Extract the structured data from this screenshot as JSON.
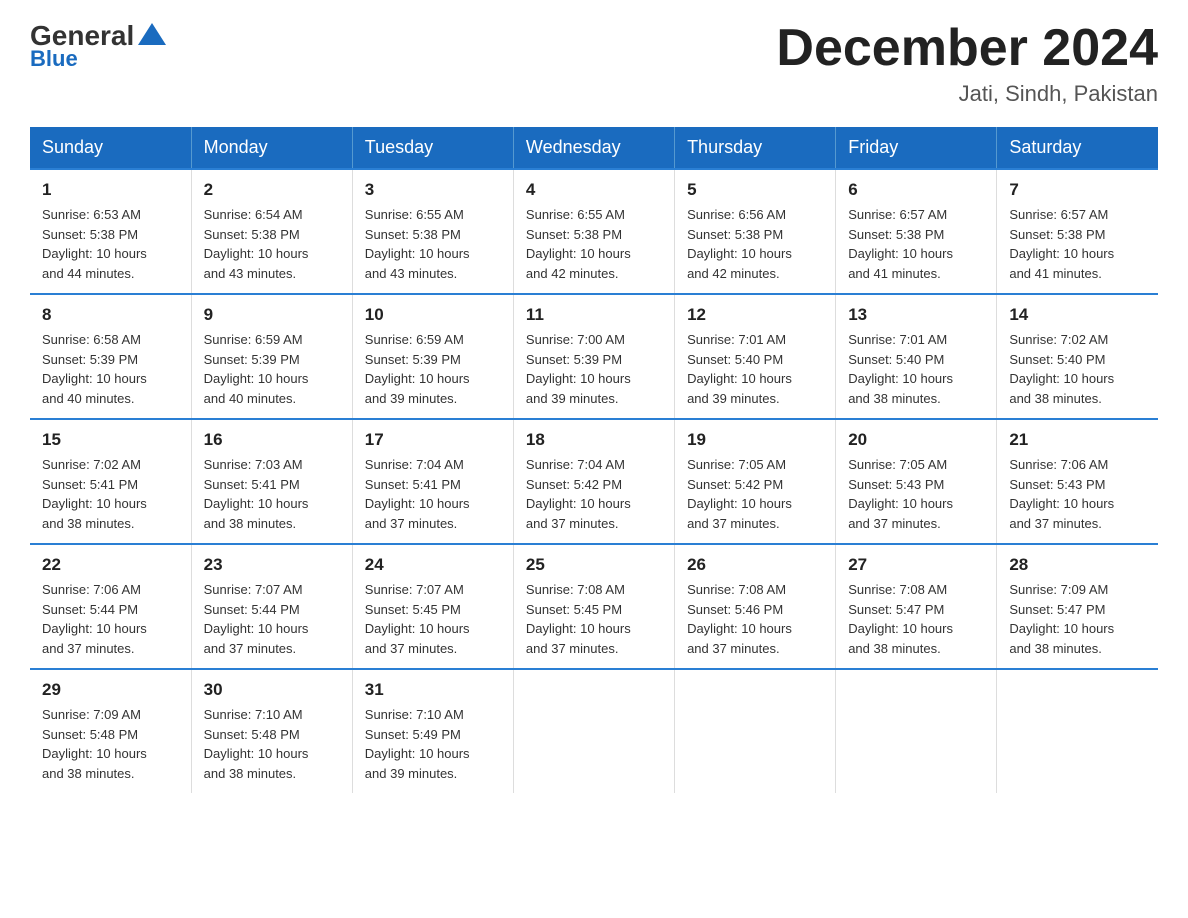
{
  "logo": {
    "general": "General",
    "blue": "Blue"
  },
  "title": "December 2024",
  "location": "Jati, Sindh, Pakistan",
  "days_of_week": [
    "Sunday",
    "Monday",
    "Tuesday",
    "Wednesday",
    "Thursday",
    "Friday",
    "Saturday"
  ],
  "weeks": [
    [
      {
        "day": "1",
        "sunrise": "6:53 AM",
        "sunset": "5:38 PM",
        "daylight": "10 hours and 44 minutes."
      },
      {
        "day": "2",
        "sunrise": "6:54 AM",
        "sunset": "5:38 PM",
        "daylight": "10 hours and 43 minutes."
      },
      {
        "day": "3",
        "sunrise": "6:55 AM",
        "sunset": "5:38 PM",
        "daylight": "10 hours and 43 minutes."
      },
      {
        "day": "4",
        "sunrise": "6:55 AM",
        "sunset": "5:38 PM",
        "daylight": "10 hours and 42 minutes."
      },
      {
        "day": "5",
        "sunrise": "6:56 AM",
        "sunset": "5:38 PM",
        "daylight": "10 hours and 42 minutes."
      },
      {
        "day": "6",
        "sunrise": "6:57 AM",
        "sunset": "5:38 PM",
        "daylight": "10 hours and 41 minutes."
      },
      {
        "day": "7",
        "sunrise": "6:57 AM",
        "sunset": "5:38 PM",
        "daylight": "10 hours and 41 minutes."
      }
    ],
    [
      {
        "day": "8",
        "sunrise": "6:58 AM",
        "sunset": "5:39 PM",
        "daylight": "10 hours and 40 minutes."
      },
      {
        "day": "9",
        "sunrise": "6:59 AM",
        "sunset": "5:39 PM",
        "daylight": "10 hours and 40 minutes."
      },
      {
        "day": "10",
        "sunrise": "6:59 AM",
        "sunset": "5:39 PM",
        "daylight": "10 hours and 39 minutes."
      },
      {
        "day": "11",
        "sunrise": "7:00 AM",
        "sunset": "5:39 PM",
        "daylight": "10 hours and 39 minutes."
      },
      {
        "day": "12",
        "sunrise": "7:01 AM",
        "sunset": "5:40 PM",
        "daylight": "10 hours and 39 minutes."
      },
      {
        "day": "13",
        "sunrise": "7:01 AM",
        "sunset": "5:40 PM",
        "daylight": "10 hours and 38 minutes."
      },
      {
        "day": "14",
        "sunrise": "7:02 AM",
        "sunset": "5:40 PM",
        "daylight": "10 hours and 38 minutes."
      }
    ],
    [
      {
        "day": "15",
        "sunrise": "7:02 AM",
        "sunset": "5:41 PM",
        "daylight": "10 hours and 38 minutes."
      },
      {
        "day": "16",
        "sunrise": "7:03 AM",
        "sunset": "5:41 PM",
        "daylight": "10 hours and 38 minutes."
      },
      {
        "day": "17",
        "sunrise": "7:04 AM",
        "sunset": "5:41 PM",
        "daylight": "10 hours and 37 minutes."
      },
      {
        "day": "18",
        "sunrise": "7:04 AM",
        "sunset": "5:42 PM",
        "daylight": "10 hours and 37 minutes."
      },
      {
        "day": "19",
        "sunrise": "7:05 AM",
        "sunset": "5:42 PM",
        "daylight": "10 hours and 37 minutes."
      },
      {
        "day": "20",
        "sunrise": "7:05 AM",
        "sunset": "5:43 PM",
        "daylight": "10 hours and 37 minutes."
      },
      {
        "day": "21",
        "sunrise": "7:06 AM",
        "sunset": "5:43 PM",
        "daylight": "10 hours and 37 minutes."
      }
    ],
    [
      {
        "day": "22",
        "sunrise": "7:06 AM",
        "sunset": "5:44 PM",
        "daylight": "10 hours and 37 minutes."
      },
      {
        "day": "23",
        "sunrise": "7:07 AM",
        "sunset": "5:44 PM",
        "daylight": "10 hours and 37 minutes."
      },
      {
        "day": "24",
        "sunrise": "7:07 AM",
        "sunset": "5:45 PM",
        "daylight": "10 hours and 37 minutes."
      },
      {
        "day": "25",
        "sunrise": "7:08 AM",
        "sunset": "5:45 PM",
        "daylight": "10 hours and 37 minutes."
      },
      {
        "day": "26",
        "sunrise": "7:08 AM",
        "sunset": "5:46 PM",
        "daylight": "10 hours and 37 minutes."
      },
      {
        "day": "27",
        "sunrise": "7:08 AM",
        "sunset": "5:47 PM",
        "daylight": "10 hours and 38 minutes."
      },
      {
        "day": "28",
        "sunrise": "7:09 AM",
        "sunset": "5:47 PM",
        "daylight": "10 hours and 38 minutes."
      }
    ],
    [
      {
        "day": "29",
        "sunrise": "7:09 AM",
        "sunset": "5:48 PM",
        "daylight": "10 hours and 38 minutes."
      },
      {
        "day": "30",
        "sunrise": "7:10 AM",
        "sunset": "5:48 PM",
        "daylight": "10 hours and 38 minutes."
      },
      {
        "day": "31",
        "sunrise": "7:10 AM",
        "sunset": "5:49 PM",
        "daylight": "10 hours and 39 minutes."
      },
      null,
      null,
      null,
      null
    ]
  ],
  "labels": {
    "sunrise": "Sunrise:",
    "sunset": "Sunset:",
    "daylight": "Daylight:"
  }
}
